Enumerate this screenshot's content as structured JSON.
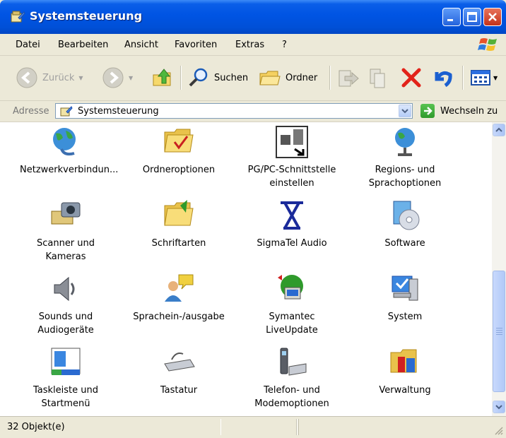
{
  "window": {
    "title": "Systemsteuerung"
  },
  "menu": [
    {
      "label": "Datei",
      "accel": "D"
    },
    {
      "label": "Bearbeiten",
      "accel": "B"
    },
    {
      "label": "Ansicht",
      "accel": "A"
    },
    {
      "label": "Favoriten",
      "accel": "F"
    },
    {
      "label": "Extras",
      "accel": "x"
    },
    {
      "label": "?",
      "accel": "?"
    }
  ],
  "toolbar": {
    "back_label": "Zurück",
    "search_label": "Suchen",
    "folders_label": "Ordner"
  },
  "address": {
    "label": "Adresse",
    "value": "Systemsteuerung",
    "go_label": "Wechseln zu"
  },
  "items": [
    {
      "label": "Netzwerkverbindun...",
      "icon": "network-globe-icon"
    },
    {
      "label": "Ordneroptionen",
      "icon": "folder-options-icon"
    },
    {
      "label": "PG/PC-Schnittstelle einstellen",
      "icon": "pg-pc-interface-icon"
    },
    {
      "label": "Regions- und Sprachoptionen",
      "icon": "regional-globe-icon"
    },
    {
      "label": "Scanner und Kameras",
      "icon": "scanner-camera-icon"
    },
    {
      "label": "Schriftarten",
      "icon": "fonts-folder-icon"
    },
    {
      "label": "SigmaTel Audio",
      "icon": "sigmatel-audio-icon"
    },
    {
      "label": "Software",
      "icon": "software-cd-icon"
    },
    {
      "label": "Sounds und Audiogeräte",
      "icon": "speaker-icon"
    },
    {
      "label": "Sprachein-/ausgabe",
      "icon": "speech-icon"
    },
    {
      "label": "Symantec LiveUpdate",
      "icon": "liveupdate-icon"
    },
    {
      "label": "System",
      "icon": "system-computer-icon"
    },
    {
      "label": "Taskleiste und Startmenü",
      "icon": "taskbar-icon"
    },
    {
      "label": "Tastatur",
      "icon": "keyboard-icon"
    },
    {
      "label": "Telefon- und Modemoptionen",
      "icon": "phone-modem-icon"
    },
    {
      "label": "Verwaltung",
      "icon": "admin-tools-icon"
    }
  ],
  "status": {
    "count_text": "32 Objekt(e)"
  },
  "colors": {
    "titlebar": "#0054e3",
    "window_bg": "#ece9d8",
    "content_bg": "#ffffff"
  }
}
